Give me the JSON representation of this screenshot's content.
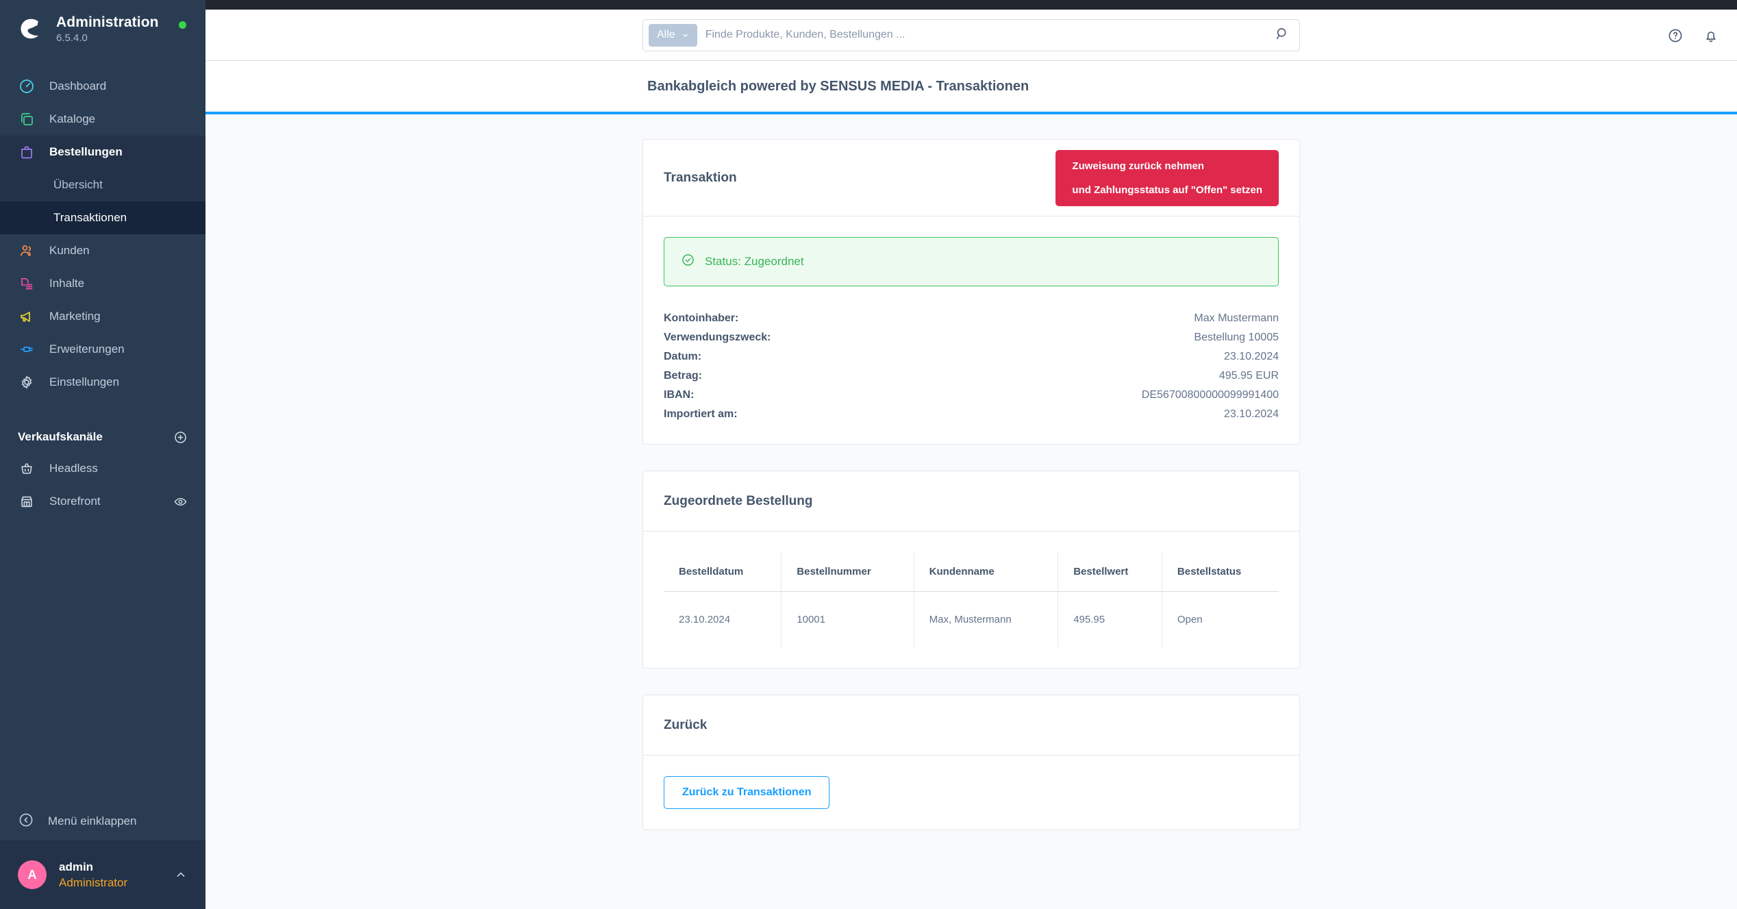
{
  "sidebar": {
    "brand": {
      "title": "Administration",
      "version": "6.5.4.0",
      "status_dot_color": "#37d649"
    },
    "items": [
      {
        "label": "Dashboard",
        "icon": "dashboard-icon",
        "color": "#4dd2e8"
      },
      {
        "label": "Kataloge",
        "icon": "catalogs-icon",
        "color": "#3ecf8e"
      },
      {
        "label": "Bestellungen",
        "icon": "orders-icon",
        "color": "#a077f0"
      },
      {
        "label": "Kunden",
        "icon": "customers-icon",
        "color": "#f58b4c"
      },
      {
        "label": "Inhalte",
        "icon": "content-icon",
        "color": "#ee4ba4"
      },
      {
        "label": "Marketing",
        "icon": "marketing-icon",
        "color": "#f0d330"
      },
      {
        "label": "Erweiterungen",
        "icon": "extensions-icon",
        "color": "#1f9eff"
      },
      {
        "label": "Einstellungen",
        "icon": "settings-gear-icon",
        "color": "#c2cdda"
      }
    ],
    "orders_children": [
      {
        "label": "Übersicht",
        "active": false
      },
      {
        "label": "Transaktionen",
        "active": true
      }
    ],
    "sales_channels": {
      "title": "Verkaufskanäle",
      "add_label": "plus-circle-icon",
      "channels": [
        {
          "label": "Headless",
          "icon": "basket-icon",
          "has_preview": false
        },
        {
          "label": "Storefront",
          "icon": "storefront-icon",
          "has_preview": true
        }
      ]
    },
    "collapse_label": "Menü einklappen",
    "user": {
      "initial": "A",
      "name": "admin",
      "role": "Administrator",
      "avatar_color": "#ff6ba6"
    }
  },
  "topbar": {
    "search": {
      "scope_label": "Alle",
      "placeholder": "Finde Produkte, Kunden, Bestellungen ...",
      "value": ""
    },
    "help_icon": "help-circle-icon",
    "notification_icon": "bell-icon"
  },
  "page": {
    "title": "Bankabgleich powered by SENSUS MEDIA - Transaktionen",
    "accent_color": "#189eff"
  },
  "transaction_card": {
    "title": "Transaktion",
    "action_button": {
      "line1": "Zuweisung zurück nehmen",
      "line2": "und Zahlungsstatus auf \"Offen\" setzen",
      "color": "#de294c"
    },
    "status_alert": {
      "text": "Status: Zugeordnet",
      "icon": "check-circle-icon",
      "color": "#37b55a"
    },
    "fields": [
      {
        "label": "Kontoinhaber:",
        "value": "Max Mustermann"
      },
      {
        "label": "Verwendungszweck:",
        "value": "Bestellung 10005"
      },
      {
        "label": "Datum:",
        "value": "23.10.2024"
      },
      {
        "label": "Betrag:",
        "value": "495.95 EUR"
      },
      {
        "label": "IBAN:",
        "value": "DE56700800000099991400"
      },
      {
        "label": "Importiert am:",
        "value": "23.10.2024"
      }
    ]
  },
  "order_card": {
    "title": "Zugeordnete Bestellung",
    "columns": [
      "Bestelldatum",
      "Bestellnummer",
      "Kundenname",
      "Bestellwert",
      "Bestellstatus"
    ],
    "rows": [
      [
        "23.10.2024",
        "10001",
        "Max, Mustermann",
        "495.95",
        "Open"
      ]
    ]
  },
  "back_card": {
    "title": "Zurück",
    "button_label": "Zurück zu Transaktionen"
  }
}
